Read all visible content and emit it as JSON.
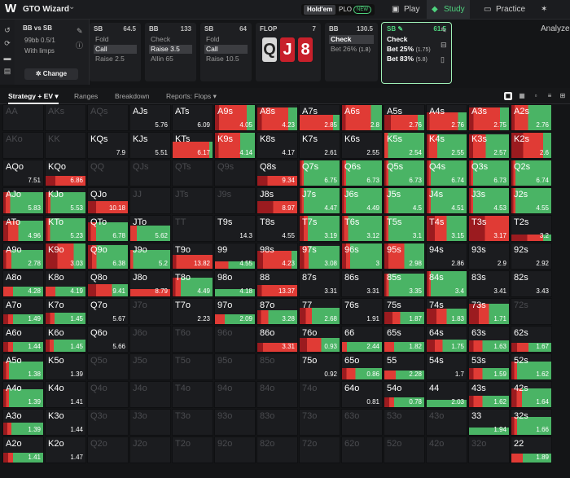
{
  "app": {
    "logo": "W",
    "name": "GTO Wizard"
  },
  "game_types": {
    "holdem": "Hold'em",
    "plo": "PLO",
    "new_badge": "NEW"
  },
  "nav": [
    {
      "label": "Play",
      "icon": "play-icon",
      "active": false
    },
    {
      "label": "Study",
      "icon": "study-icon",
      "active": true
    },
    {
      "label": "Practice",
      "icon": "practice-icon",
      "active": false
    },
    {
      "label": "Analyze",
      "icon": "analyze-icon",
      "active": false
    }
  ],
  "matchup": {
    "title": "BB vs SB",
    "stakes": "99bb 0.5/1",
    "limps": "With limps",
    "change_label": "Change"
  },
  "actions": [
    {
      "pos": "SB",
      "stack": "64.5",
      "options": [
        "Fold",
        "Call",
        "Raise 2.5"
      ],
      "selected": 1
    },
    {
      "pos": "BB",
      "stack": "133",
      "options": [
        "Check",
        "Raise 3.5",
        "Allin 65"
      ],
      "selected": 1
    },
    {
      "pos": "SB",
      "stack": "64",
      "options": [
        "Fold",
        "Call",
        "Raise 10.5"
      ],
      "selected": 1
    }
  ],
  "flop": {
    "label": "FLOP",
    "pot": "7",
    "cards": [
      "Q",
      "J",
      "8"
    ],
    "colors": [
      "gray",
      "red",
      "red"
    ]
  },
  "bb_col": {
    "pos": "BB",
    "stack": "130.5",
    "options": [
      "Check",
      "Bet 26%"
    ],
    "sizes": [
      "",
      "(1.8)"
    ],
    "selected": 0
  },
  "current": {
    "pos": "SB",
    "stack": "61.5",
    "options": [
      {
        "label": "Check",
        "size": ""
      },
      {
        "label": "Bet 25%",
        "size": "(1.75)"
      },
      {
        "label": "Bet 83%",
        "size": "(5.8)"
      }
    ]
  },
  "tabs": [
    "Strategy + EV",
    "Ranges",
    "Breakdown",
    "Reports: Flops"
  ],
  "colors": {
    "check": "#4ab465",
    "bet_small": "#e03b35",
    "bet_big": "#9b1b1f",
    "accent": "#4ed37e"
  },
  "grid": [
    [
      [
        "AA",
        "",
        0,
        0,
        0,
        1
      ],
      [
        "AKs",
        "",
        0,
        0,
        0,
        1
      ],
      [
        "AQs",
        "",
        0,
        0,
        0,
        1
      ],
      [
        "AJs",
        "5.76",
        0,
        0,
        0,
        0
      ],
      [
        "ATs",
        "6.09",
        0,
        0,
        0,
        0
      ],
      [
        "A9s",
        "4.05",
        0.2,
        0.7,
        0.1,
        0
      ],
      [
        "A8s",
        "4.23",
        0.2,
        0.6,
        0.1,
        0
      ],
      [
        "A7s",
        "2.85",
        0.1,
        0.5,
        0,
        0
      ],
      [
        "A6s",
        "2.8",
        0.3,
        0.7,
        0.1,
        0
      ],
      [
        "A5s",
        "2.76",
        0.1,
        0.4,
        0.1,
        0
      ],
      [
        "A4s",
        "2.76",
        0.15,
        0.5,
        0.05,
        0
      ],
      [
        "A3s",
        "2.75",
        0.2,
        0.6,
        0.1,
        0
      ],
      [
        "A2s",
        "2.76",
        0.7,
        0.4,
        0.1,
        0
      ]
    ],
    [
      [
        "AKo",
        "",
        0,
        0,
        0,
        1
      ],
      [
        "KK",
        "",
        0,
        0,
        0,
        1
      ],
      [
        "KQs",
        "7.9",
        0,
        0,
        0,
        0
      ],
      [
        "KJs",
        "5.51",
        0,
        0,
        0,
        0
      ],
      [
        "KTs",
        "6.17",
        0.05,
        0.6,
        0,
        0
      ],
      [
        "K9s",
        "4.14",
        0.4,
        0.6,
        0.1,
        0
      ],
      [
        "K8s",
        "4.17",
        0,
        0,
        0,
        0
      ],
      [
        "K7s",
        "2.61",
        0,
        0,
        0,
        0
      ],
      [
        "K6s",
        "2.55",
        0,
        0,
        0,
        0
      ],
      [
        "K5s",
        "2.54",
        1,
        0.1,
        0,
        0
      ],
      [
        "K4s",
        "2.55",
        0.7,
        0.2,
        0.05,
        0
      ],
      [
        "K3s",
        "2.57",
        0.55,
        0.3,
        0.1,
        0
      ],
      [
        "K2s",
        "2.6",
        0.2,
        0.5,
        0.3,
        0
      ]
    ],
    [
      [
        "AQo",
        "7.51",
        0,
        0,
        0,
        0
      ],
      [
        "KQo",
        "6.86",
        0,
        0.3,
        0.1,
        0
      ],
      [
        "QQ",
        "",
        0,
        0,
        0,
        1
      ],
      [
        "QJs",
        "",
        0,
        0,
        0,
        1
      ],
      [
        "QTs",
        "",
        0,
        0,
        0,
        1
      ],
      [
        "Q9s",
        "",
        0,
        0,
        0,
        1
      ],
      [
        "Q8s",
        "9.34",
        0,
        0.3,
        0.1,
        0
      ],
      [
        "Q7s",
        "6.75",
        0.9,
        0.05,
        0.05,
        0
      ],
      [
        "Q6s",
        "6.73",
        0.9,
        0.05,
        0.05,
        0
      ],
      [
        "Q5s",
        "6.73",
        0.9,
        0.05,
        0.05,
        0
      ],
      [
        "Q4s",
        "6.74",
        0.9,
        0.05,
        0.05,
        0
      ],
      [
        "Q3s",
        "6.73",
        0.9,
        0.05,
        0.05,
        0
      ],
      [
        "Q2s",
        "6.74",
        0.9,
        0.05,
        0.05,
        0
      ]
    ],
    [
      [
        "AJo",
        "5.83",
        0.7,
        0.1,
        0.05,
        0
      ],
      [
        "KJo",
        "5.53",
        0.75,
        0.05,
        0.05,
        0
      ],
      [
        "QJo",
        "10.18",
        0,
        0.4,
        0.1,
        0
      ],
      [
        "JJ",
        "",
        0,
        0,
        0,
        1
      ],
      [
        "JTs",
        "",
        0,
        0,
        0,
        1
      ],
      [
        "J9s",
        "",
        0,
        0,
        0,
        1
      ],
      [
        "J8s",
        "8.97",
        0,
        0.3,
        0.2,
        0
      ],
      [
        "J7s",
        "4.47",
        0.9,
        0.05,
        0.05,
        0
      ],
      [
        "J6s",
        "4.49",
        0.9,
        0.05,
        0.05,
        0
      ],
      [
        "J5s",
        "4.5",
        0.9,
        0.05,
        0.05,
        0
      ],
      [
        "J4s",
        "4.51",
        0.9,
        0.05,
        0.05,
        0
      ],
      [
        "J3s",
        "4.53",
        0.9,
        0.05,
        0.05,
        0
      ],
      [
        "J2s",
        "4.55",
        0.9,
        0.05,
        0.05,
        0
      ]
    ],
    [
      [
        "ATo",
        "4.96",
        0.5,
        0.2,
        0.1,
        0
      ],
      [
        "KTo",
        "5.23",
        0.8,
        0.05,
        0.05,
        0
      ],
      [
        "QTo",
        "6.78",
        0.6,
        0.1,
        0.05,
        0
      ],
      [
        "JTo",
        "5.62",
        0.5,
        0.1,
        0,
        0
      ],
      [
        "TT",
        "",
        0,
        0,
        0,
        1
      ],
      [
        "T9s",
        "14.3",
        0,
        0,
        0,
        0
      ],
      [
        "T8s",
        "4.55",
        0,
        0,
        0,
        0
      ],
      [
        "T7s",
        "3.19",
        0.8,
        0.1,
        0.1,
        0
      ],
      [
        "T6s",
        "3.12",
        0.85,
        0.1,
        0.05,
        0
      ],
      [
        "T5s",
        "3.1",
        0.9,
        0.05,
        0.05,
        0
      ],
      [
        "T4s",
        "3.15",
        0.5,
        0.3,
        0.2,
        0
      ],
      [
        "T3s",
        "3.17",
        0,
        0.6,
        0.4,
        0
      ],
      [
        "T2s",
        "3.2",
        0.05,
        0.1,
        0.1,
        0
      ]
    ],
    [
      [
        "A9o",
        "2.78",
        0.6,
        0.1,
        0.05,
        0
      ],
      [
        "K9o",
        "3.03",
        0.3,
        0.4,
        0.3,
        0
      ],
      [
        "Q9o",
        "6.38",
        0.75,
        0.1,
        0.1,
        0
      ],
      [
        "J9o",
        "5.2",
        0.7,
        0.05,
        0,
        0
      ],
      [
        "T9o",
        "13.82",
        0,
        0.5,
        0.05,
        0
      ],
      [
        "99",
        "4.55",
        0.2,
        0.1,
        0,
        0
      ],
      [
        "98s",
        "4.23",
        0.1,
        0.5,
        0.1,
        0
      ],
      [
        "97s",
        "3.08",
        0.7,
        0.1,
        0.1,
        0
      ],
      [
        "96s",
        "3",
        0.8,
        0.1,
        0.1,
        0
      ],
      [
        "95s",
        "2.98",
        0.5,
        0.4,
        0.1,
        0
      ],
      [
        "94s",
        "2.86",
        0,
        0,
        0,
        0
      ],
      [
        "93s",
        "2.9",
        0,
        0,
        0,
        0
      ],
      [
        "92s",
        "2.92",
        0,
        0,
        0,
        0
      ]
    ],
    [
      [
        "A8o",
        "4.28",
        0.3,
        0.1,
        0,
        0
      ],
      [
        "K8o",
        "4.19",
        0.3,
        0.1,
        0,
        0
      ],
      [
        "Q8o",
        "9.41",
        0.2,
        0.2,
        0.1,
        0
      ],
      [
        "J8o",
        "8.79",
        0,
        0.3,
        0,
        0
      ],
      [
        "T8o",
        "4.49",
        0.6,
        0.1,
        0.05,
        0
      ],
      [
        "98o",
        "4.18",
        0.3,
        0,
        0,
        0
      ],
      [
        "88",
        "13.37",
        0,
        0.4,
        0.05,
        0
      ],
      [
        "87s",
        "3.31",
        0,
        0,
        0,
        0
      ],
      [
        "86s",
        "3.31",
        0,
        0,
        0,
        0
      ],
      [
        "85s",
        "3.35",
        0.8,
        0.05,
        0.05,
        0
      ],
      [
        "84s",
        "3.4",
        0.9,
        0.05,
        0.05,
        0
      ],
      [
        "83s",
        "3.41",
        0,
        0,
        0,
        0
      ],
      [
        "82s",
        "3.43",
        0,
        0,
        0,
        0
      ]
    ],
    [
      [
        "A7o",
        "1.49",
        0.3,
        0.05,
        0.05,
        0
      ],
      [
        "K7o",
        "1.45",
        0.35,
        0.05,
        0.05,
        0
      ],
      [
        "Q7o",
        "5.67",
        0,
        0,
        0,
        0
      ],
      [
        "J7o",
        "",
        0,
        0,
        0,
        1
      ],
      [
        "T7o",
        "2.23",
        0,
        0,
        0,
        0
      ],
      [
        "97o",
        "2.09",
        0.3,
        0.1,
        0,
        0
      ],
      [
        "87o",
        "3.28",
        0.4,
        0.1,
        0.05,
        0
      ],
      [
        "77",
        "2.68",
        0.45,
        0.1,
        0.1,
        0
      ],
      [
        "76s",
        "1.91",
        0,
        0,
        0,
        0
      ],
      [
        "75s",
        "1.87",
        0.3,
        0.1,
        0.1,
        0
      ],
      [
        "74s",
        "1.83",
        0.3,
        0.15,
        0.15,
        0
      ],
      [
        "73s",
        "1.71",
        0.4,
        0.2,
        0.2,
        0
      ],
      [
        "72s",
        "",
        0,
        0,
        0,
        1
      ]
    ],
    [
      [
        "A6o",
        "1.44",
        0.3,
        0.05,
        0.05,
        0
      ],
      [
        "K6o",
        "1.45",
        0.4,
        0.05,
        0.05,
        0
      ],
      [
        "Q6o",
        "5.66",
        0,
        0,
        0,
        0
      ],
      [
        "J6o",
        "",
        0,
        0,
        0,
        1
      ],
      [
        "T6o",
        "",
        0,
        0,
        0,
        1
      ],
      [
        "96o",
        "",
        0,
        0,
        0,
        1
      ],
      [
        "86o",
        "3.31",
        0,
        0.3,
        0.05,
        0
      ],
      [
        "76o",
        "0.93",
        0.25,
        0.2,
        0.1,
        0
      ],
      [
        "66",
        "2.44",
        0.35,
        0.05,
        0,
        0
      ],
      [
        "65s",
        "1.82",
        0.3,
        0.1,
        0,
        0
      ],
      [
        "64s",
        "1.75",
        0.3,
        0.1,
        0.1,
        0
      ],
      [
        "63s",
        "1.63",
        0.3,
        0.1,
        0.05,
        0
      ],
      [
        "62s",
        "1.67",
        0.2,
        0.1,
        0.05,
        0
      ]
    ],
    [
      [
        "A5o",
        "1.38",
        0.6,
        0.05,
        0.05,
        0
      ],
      [
        "K5o",
        "1.39",
        0,
        0,
        0,
        0
      ],
      [
        "Q5o",
        "",
        0,
        0,
        0,
        1
      ],
      [
        "J5o",
        "",
        0,
        0,
        0,
        1
      ],
      [
        "T5o",
        "",
        0,
        0,
        0,
        1
      ],
      [
        "95o",
        "",
        0,
        0,
        0,
        1
      ],
      [
        "85o",
        "",
        0,
        0,
        0,
        1
      ],
      [
        "75o",
        "0.92",
        0,
        0,
        0,
        0
      ],
      [
        "65o",
        "0.86",
        0.3,
        0.1,
        0.05,
        0
      ],
      [
        "55",
        "2.28",
        0.25,
        0.1,
        0,
        0
      ],
      [
        "54s",
        "1.7",
        0,
        0,
        0,
        0
      ],
      [
        "53s",
        "1.59",
        0.3,
        0.1,
        0.05,
        0
      ],
      [
        "52s",
        "1.62",
        0.6,
        0.05,
        0.05,
        0
      ]
    ],
    [
      [
        "A4o",
        "1.39",
        0.6,
        0.05,
        0.05,
        0
      ],
      [
        "K4o",
        "1.41",
        0,
        0,
        0,
        0
      ],
      [
        "Q4o",
        "",
        0,
        0,
        0,
        1
      ],
      [
        "J4o",
        "",
        0,
        0,
        0,
        1
      ],
      [
        "T4o",
        "",
        0,
        0,
        0,
        1
      ],
      [
        "94o",
        "",
        0,
        0,
        0,
        1
      ],
      [
        "84o",
        "",
        0,
        0,
        0,
        1
      ],
      [
        "74o",
        "",
        0,
        0,
        0,
        1
      ],
      [
        "64o",
        "0.81",
        0,
        0,
        0,
        0
      ],
      [
        "54o",
        "0.78",
        0.3,
        0.05,
        0.05,
        0
      ],
      [
        "44",
        "2.03",
        0.3,
        0,
        0,
        0
      ],
      [
        "43s",
        "1.62",
        0.3,
        0.1,
        0.05,
        0
      ],
      [
        "42s",
        "1.64",
        0.55,
        0.1,
        0.1,
        0
      ]
    ],
    [
      [
        "A3o",
        "1.39",
        0.4,
        0.05,
        0.05,
        0
      ],
      [
        "K3o",
        "1.44",
        0,
        0,
        0,
        0
      ],
      [
        "Q3o",
        "",
        0,
        0,
        0,
        1
      ],
      [
        "J3o",
        "",
        0,
        0,
        0,
        1
      ],
      [
        "T3o",
        "",
        0,
        0,
        0,
        1
      ],
      [
        "93o",
        "",
        0,
        0,
        0,
        1
      ],
      [
        "83o",
        "",
        0,
        0,
        0,
        1
      ],
      [
        "73o",
        "",
        0,
        0,
        0,
        1
      ],
      [
        "63o",
        "",
        0,
        0,
        0,
        1
      ],
      [
        "53o",
        "",
        0,
        0,
        0,
        1
      ],
      [
        "43o",
        "",
        0,
        0,
        0,
        1
      ],
      [
        "33",
        "1.94",
        0.3,
        0,
        0,
        0
      ],
      [
        "32s",
        "1.66",
        0.6,
        0.05,
        0.05,
        0
      ]
    ],
    [
      [
        "A2o",
        "1.41",
        0.3,
        0.05,
        0.05,
        0
      ],
      [
        "K2o",
        "1.47",
        0,
        0,
        0,
        0
      ],
      [
        "Q2o",
        "",
        0,
        0,
        0,
        1
      ],
      [
        "J2o",
        "",
        0,
        0,
        0,
        1
      ],
      [
        "T2o",
        "",
        0,
        0,
        0,
        1
      ],
      [
        "92o",
        "",
        0,
        0,
        0,
        1
      ],
      [
        "82o",
        "",
        0,
        0,
        0,
        1
      ],
      [
        "72o",
        "",
        0,
        0,
        0,
        1
      ],
      [
        "62o",
        "",
        0,
        0,
        0,
        1
      ],
      [
        "52o",
        "",
        0,
        0,
        0,
        1
      ],
      [
        "42o",
        "",
        0,
        0,
        0,
        1
      ],
      [
        "32o",
        "",
        0,
        0,
        0,
        1
      ],
      [
        "22",
        "1.89",
        0.25,
        0.1,
        0,
        0
      ]
    ]
  ]
}
